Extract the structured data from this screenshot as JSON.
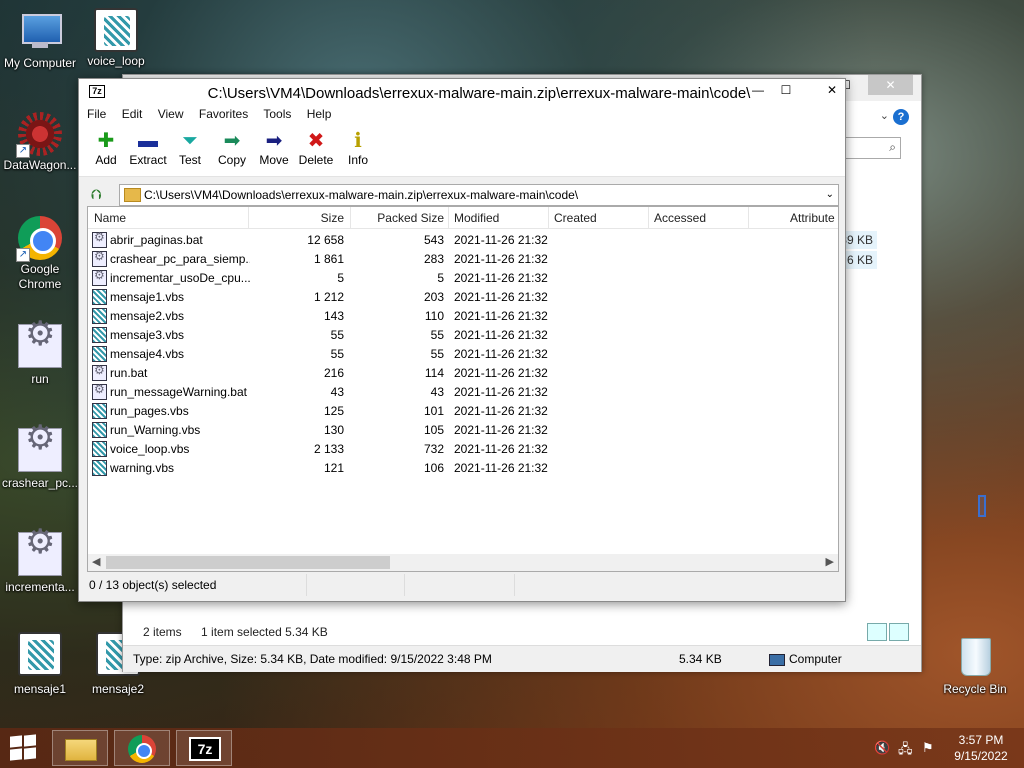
{
  "desktop": {
    "icons": [
      {
        "label": "My Computer",
        "type": "pc"
      },
      {
        "label": "voice_loop",
        "type": "script"
      },
      {
        "label": "DataWagon...",
        "type": "wagon"
      },
      {
        "label": "Google Chrome",
        "type": "chrome"
      },
      {
        "label": "run",
        "type": "gear"
      },
      {
        "label": "crashear_pc...",
        "type": "gear"
      },
      {
        "label": "incrementa...",
        "type": "gear"
      },
      {
        "label": "mensaje1",
        "type": "script"
      },
      {
        "label": "mensaje2",
        "type": "script"
      },
      {
        "label": "Recycle Bin",
        "type": "bin"
      }
    ]
  },
  "explorer": {
    "sizes": [
      "39 KB",
      "6 KB"
    ],
    "status_items": "2 items",
    "status_selected": "1 item selected  5.34 KB",
    "details_text": "Type: zip Archive, Size: 5.34 KB, Date modified: 9/15/2022 3:48 PM",
    "details_size": "5.34 KB",
    "details_location": "Computer",
    "close_glyph": "✕",
    "max_glyph": "☐"
  },
  "zip": {
    "title": "C:\\Users\\VM4\\Downloads\\errexux-malware-main.zip\\errexux-malware-main\\code\\",
    "logo_text": "7z",
    "window_buttons": {
      "min": "—",
      "max": "☐",
      "restore": "▫",
      "close": "✕"
    },
    "menu": [
      "File",
      "Edit",
      "View",
      "Favorites",
      "Tools",
      "Help"
    ],
    "toolbar": [
      {
        "label": "Add",
        "icon": "add-icon",
        "glyph": "✚",
        "color": "#1a9a1a"
      },
      {
        "label": "Extract",
        "icon": "extract-icon",
        "glyph": "▬",
        "color": "#1a2f9a"
      },
      {
        "label": "Test",
        "icon": "test-icon",
        "glyph": "⏷",
        "color": "#19a8a0"
      },
      {
        "label": "Copy",
        "icon": "copy-icon",
        "glyph": "➡",
        "color": "#1a8a5a"
      },
      {
        "label": "Move",
        "icon": "move-icon",
        "glyph": "➡",
        "color": "#1a2080"
      },
      {
        "label": "Delete",
        "icon": "delete-icon",
        "glyph": "✖",
        "color": "#d01818"
      },
      {
        "label": "Info",
        "icon": "info-icon",
        "glyph": "ℹ",
        "color": "#b8a000"
      }
    ],
    "address": "C:\\Users\\VM4\\Downloads\\errexux-malware-main.zip\\errexux-malware-main\\code\\",
    "columns": [
      "Name",
      "Size",
      "Packed Size",
      "Modified",
      "Created",
      "Accessed",
      "Attribute"
    ],
    "files": [
      {
        "name": "abrir_paginas.bat",
        "type": "bat",
        "size": "12 658",
        "packed": "543",
        "modified": "2021-11-26 21:32"
      },
      {
        "name": "crashear_pc_para_siemp...",
        "type": "bat",
        "size": "1 861",
        "packed": "283",
        "modified": "2021-11-26 21:32"
      },
      {
        "name": "incrementar_usoDe_cpu...",
        "type": "bat",
        "size": "5",
        "packed": "5",
        "modified": "2021-11-26 21:32"
      },
      {
        "name": "mensaje1.vbs",
        "type": "vbs",
        "size": "1 212",
        "packed": "203",
        "modified": "2021-11-26 21:32"
      },
      {
        "name": "mensaje2.vbs",
        "type": "vbs",
        "size": "143",
        "packed": "110",
        "modified": "2021-11-26 21:32"
      },
      {
        "name": "mensaje3.vbs",
        "type": "vbs",
        "size": "55",
        "packed": "55",
        "modified": "2021-11-26 21:32"
      },
      {
        "name": "mensaje4.vbs",
        "type": "vbs",
        "size": "55",
        "packed": "55",
        "modified": "2021-11-26 21:32"
      },
      {
        "name": "run.bat",
        "type": "bat",
        "size": "216",
        "packed": "114",
        "modified": "2021-11-26 21:32"
      },
      {
        "name": "run_messageWarning.bat",
        "type": "bat",
        "size": "43",
        "packed": "43",
        "modified": "2021-11-26 21:32"
      },
      {
        "name": "run_pages.vbs",
        "type": "vbs",
        "size": "125",
        "packed": "101",
        "modified": "2021-11-26 21:32"
      },
      {
        "name": "run_Warning.vbs",
        "type": "vbs",
        "size": "130",
        "packed": "105",
        "modified": "2021-11-26 21:32"
      },
      {
        "name": "voice_loop.vbs",
        "type": "vbs",
        "size": "2 133",
        "packed": "732",
        "modified": "2021-11-26 21:32"
      },
      {
        "name": "warning.vbs",
        "type": "vbs",
        "size": "121",
        "packed": "106",
        "modified": "2021-11-26 21:32"
      }
    ],
    "status": "0 / 13 object(s) selected"
  },
  "taskbar": {
    "clock_time": "3:57 PM",
    "clock_date": "9/15/2022",
    "apps": [
      "File Explorer",
      "Google Chrome",
      "7-Zip"
    ],
    "sz_label": "7z"
  }
}
